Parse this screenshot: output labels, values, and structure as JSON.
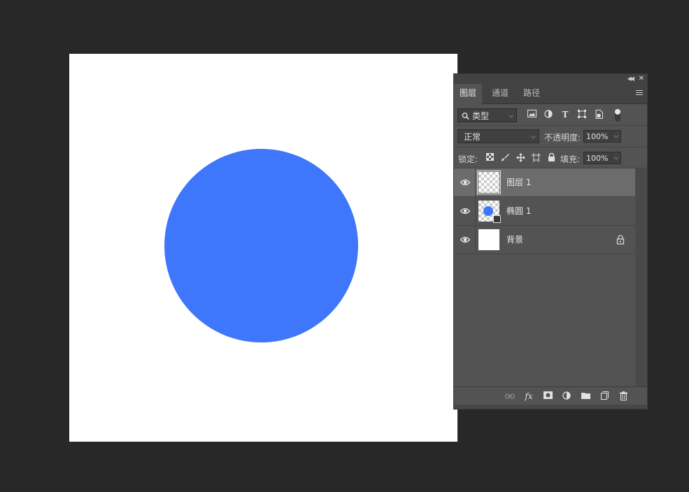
{
  "document": {
    "canvas_bg": "#ffffff",
    "ellipse_color": "#3e77fb"
  },
  "layers_panel": {
    "tabs": [
      {
        "label": "图层",
        "active": true
      },
      {
        "label": "通道",
        "active": false
      },
      {
        "label": "路径",
        "active": false
      }
    ],
    "filter": {
      "kind_label": "类型",
      "icons": [
        "image-filter-icon",
        "adjustment-filter-icon",
        "type-filter-icon",
        "shape-filter-icon",
        "smart-object-filter-icon"
      ],
      "toggle_on": true
    },
    "blend": {
      "mode": "正常",
      "opacity_label": "不透明度:",
      "opacity_value": "100%"
    },
    "lock": {
      "label": "锁定:",
      "fill_label": "填充:",
      "fill_value": "100%"
    },
    "layers": [
      {
        "name": "图层 1",
        "visible": true,
        "selected": true,
        "thumb": "transparent"
      },
      {
        "name": "椭圆 1",
        "visible": true,
        "selected": false,
        "thumb": "shape"
      },
      {
        "name": "背景",
        "visible": true,
        "selected": false,
        "thumb": "white",
        "locked": true
      }
    ],
    "bottom_icons": [
      "link-icon",
      "fx-icon",
      "mask-icon",
      "adjustment-icon",
      "folder-icon",
      "new-layer-icon",
      "trash-icon"
    ]
  }
}
